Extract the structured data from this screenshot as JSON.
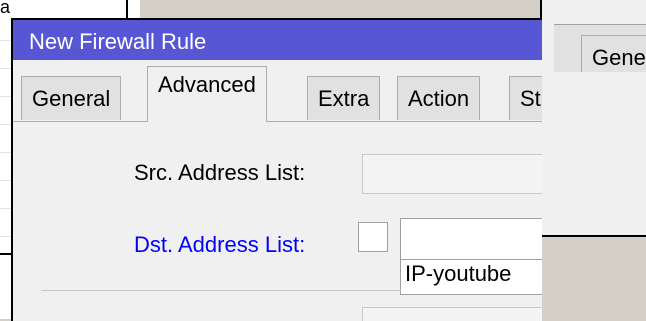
{
  "background_left": {
    "fragment": "a"
  },
  "background_right": {
    "tab_label": "Gene"
  },
  "dialog": {
    "title": "New Firewall Rule",
    "tabs": [
      {
        "label": "General",
        "active": false
      },
      {
        "label": "Advanced",
        "active": true
      },
      {
        "label": "Extra",
        "active": false
      },
      {
        "label": "Action",
        "active": false
      },
      {
        "label": "St",
        "active": false
      }
    ],
    "src_address_list": {
      "label": "Src. Address List:",
      "value": ""
    },
    "dst_address_list": {
      "label": "Dst. Address List:",
      "value": "",
      "checked": false,
      "option": "IP-youtube"
    }
  },
  "colors": {
    "titlebar": "#5757d6",
    "label_link": "#0000ff",
    "dialog_bg": "#f0f0f0"
  }
}
